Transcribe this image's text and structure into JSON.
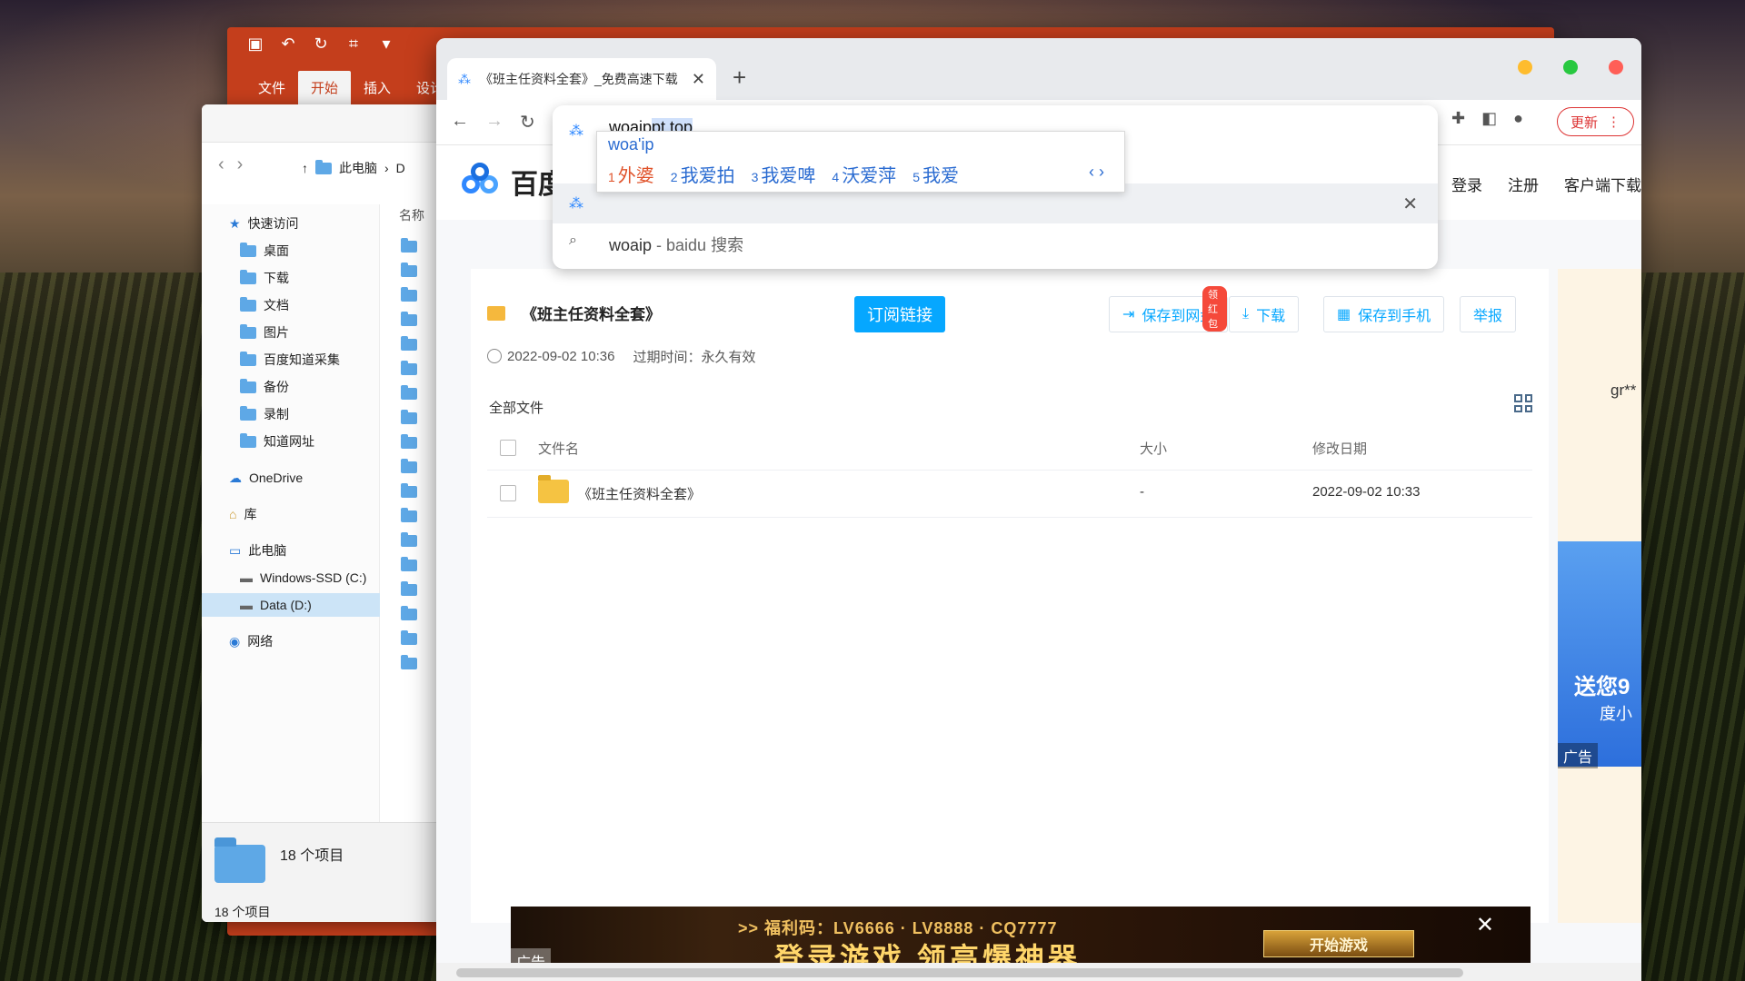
{
  "office": {
    "tabs": [
      "文件",
      "开始",
      "插入",
      "设计"
    ]
  },
  "explorer": {
    "path": [
      "此电脑",
      "D"
    ],
    "column_name": "名称",
    "sidebar": {
      "quick_access": "快速访问",
      "items": [
        "桌面",
        "下载",
        "文档",
        "图片",
        "百度知道采集",
        "备份",
        "录制",
        "知道网址"
      ],
      "onedrive": "OneDrive",
      "library": "库",
      "this_pc": "此电脑",
      "drives": [
        "Windows-SSD (C:)",
        "Data (D:)"
      ],
      "network": "网络"
    },
    "item_count": "18 个项目",
    "status_count": "18 个项目"
  },
  "browser": {
    "tab_title": "《班主任资料全套》_免费高速下载",
    "omnibox": {
      "typed": "woaip",
      "completion": "pt.top",
      "search_text": "woaip",
      "search_suffix": " - baidu 搜索"
    },
    "ime": {
      "composition": "woa'ip",
      "candidates": [
        {
          "num": "1",
          "text": "外婆"
        },
        {
          "num": "2",
          "text": "我爱拍"
        },
        {
          "num": "3",
          "text": "我爱啤"
        },
        {
          "num": "4",
          "text": "沃爱萍"
        },
        {
          "num": "5",
          "text": "我爱"
        }
      ]
    },
    "update_label": "更新",
    "colors": {
      "red": "#ff5f57",
      "yellow": "#febc2e",
      "green": "#28c840"
    }
  },
  "site": {
    "logo_text": "百度",
    "header_links": [
      "登录",
      "注册",
      "客户端下载"
    ],
    "share": {
      "title": "《班主任资料全套》",
      "subscribe": "订阅链接",
      "actions": {
        "save_cloud": "保存到网盘",
        "save_badge": "领红包",
        "download": "下载",
        "save_phone": "保存到手机",
        "report": "举报"
      },
      "created": "2022-09-02 10:36",
      "expiry": "过期时间：永久有效",
      "all_files": "全部文件",
      "columns": {
        "name": "文件名",
        "size": "大小",
        "date": "修改日期"
      },
      "rows": [
        {
          "name": "《班主任资料全套》",
          "size": "-",
          "date": "2022-09-02 10:33"
        }
      ]
    },
    "side_ad": {
      "gr": "gr**",
      "send": "送您9",
      "sub": "度小",
      "tag": "广告"
    },
    "banner": {
      "line1": ">> 福利码：LV6666 · LV8888 · CQ7777",
      "line2": "登录游戏 领高爆神器",
      "cta": "开始游戏",
      "tag": "广告"
    }
  }
}
